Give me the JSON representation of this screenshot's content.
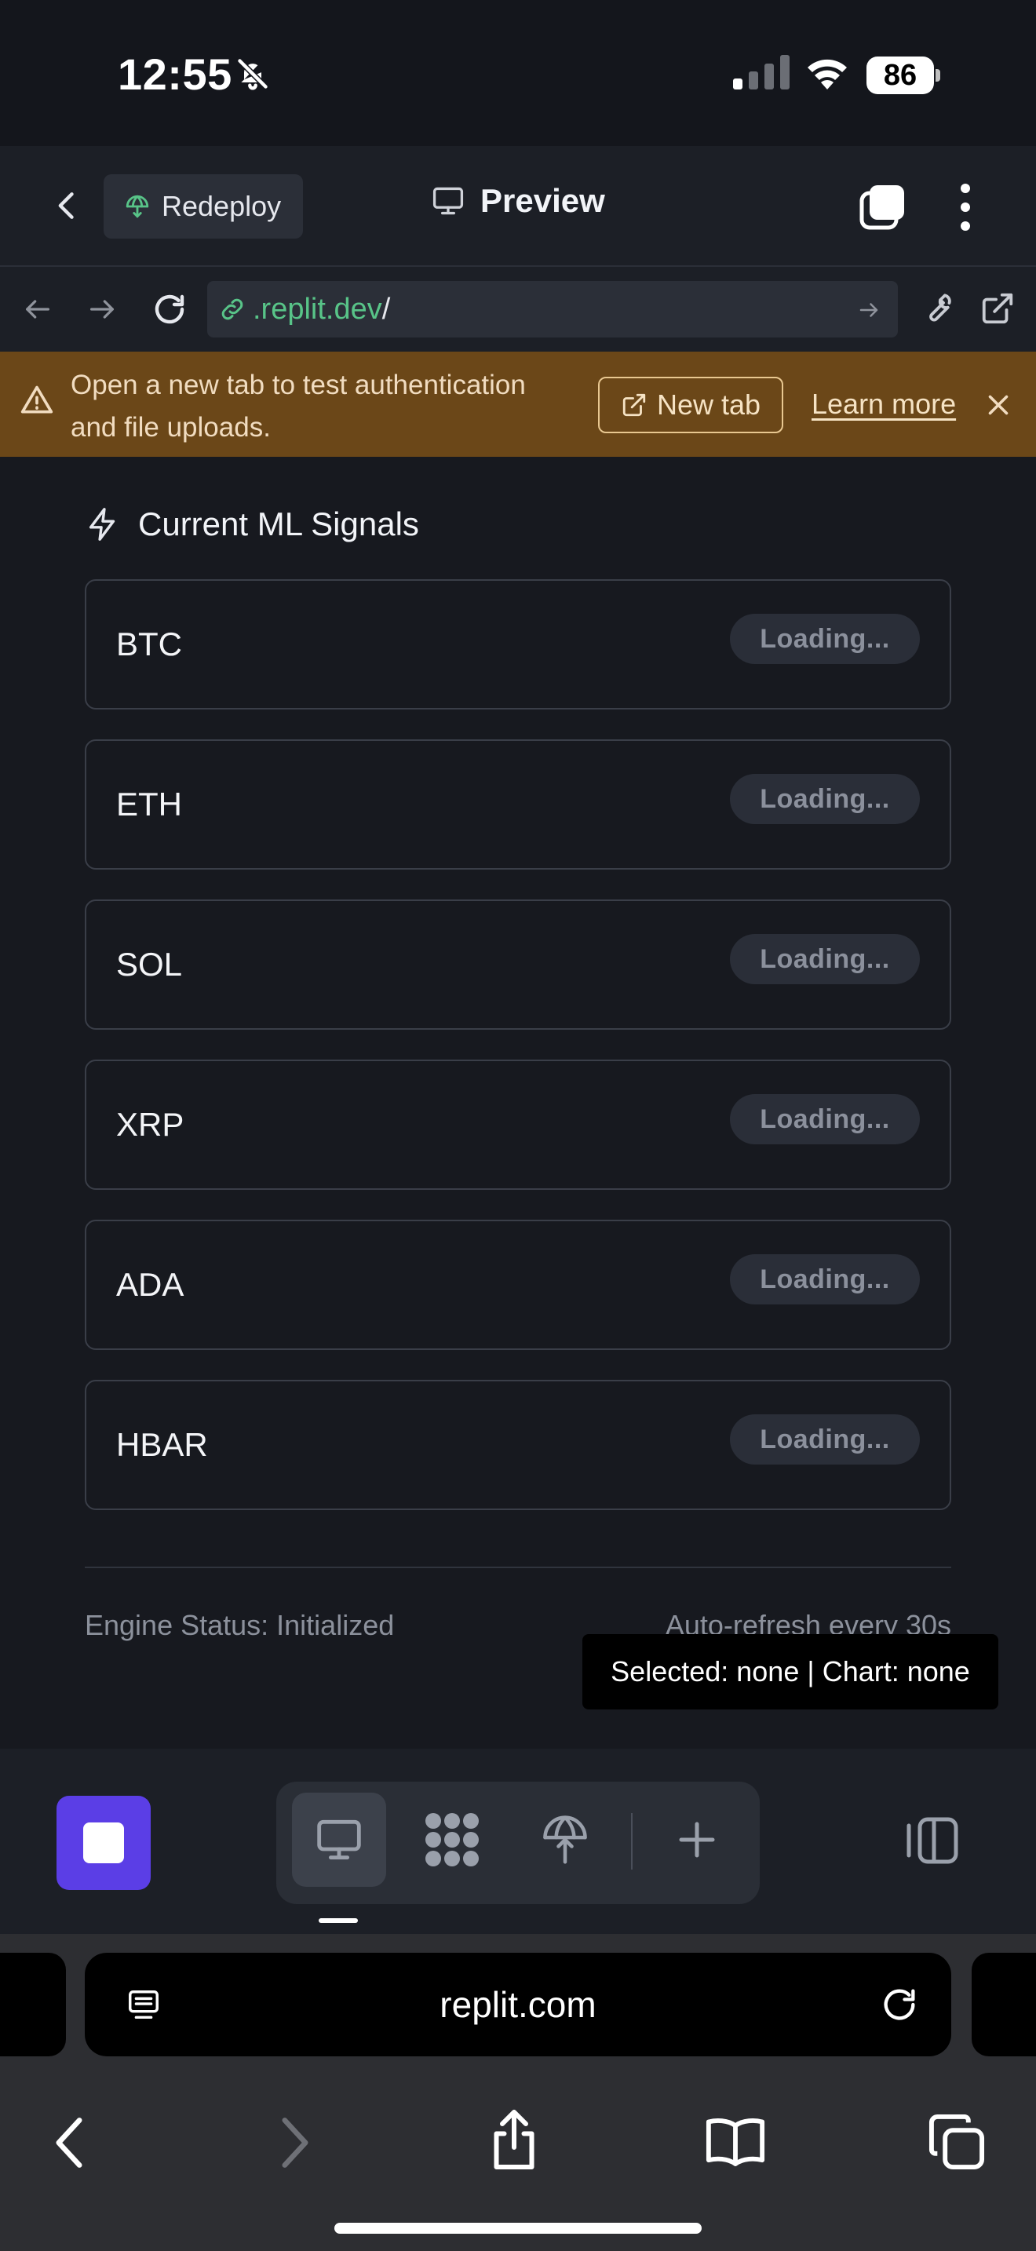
{
  "status_bar": {
    "time": "12:55",
    "battery": "86"
  },
  "topbar": {
    "redeploy_label": "Redeploy",
    "title": "Preview"
  },
  "url_bar": {
    "host_prefix": ".replit.dev",
    "path": "/"
  },
  "banner": {
    "message": "Open a new tab to test authentication and file uploads.",
    "new_tab_label": "New tab",
    "learn_more_label": "Learn more"
  },
  "signals_section": {
    "title": "Current ML Signals",
    "items": [
      {
        "symbol": "BTC",
        "status": "Loading..."
      },
      {
        "symbol": "ETH",
        "status": "Loading..."
      },
      {
        "symbol": "SOL",
        "status": "Loading..."
      },
      {
        "symbol": "XRP",
        "status": "Loading..."
      },
      {
        "symbol": "ADA",
        "status": "Loading..."
      },
      {
        "symbol": "HBAR",
        "status": "Loading..."
      }
    ]
  },
  "footer": {
    "engine_status": "Engine Status: Initialized",
    "auto_refresh": "Auto-refresh every 30s"
  },
  "tooltip": {
    "text": "Selected: none | Chart: none"
  },
  "safari": {
    "url": "replit.com"
  },
  "colors": {
    "accent": "#5b3ee6",
    "banner": "#6b4718",
    "link_green": "#58c488"
  }
}
